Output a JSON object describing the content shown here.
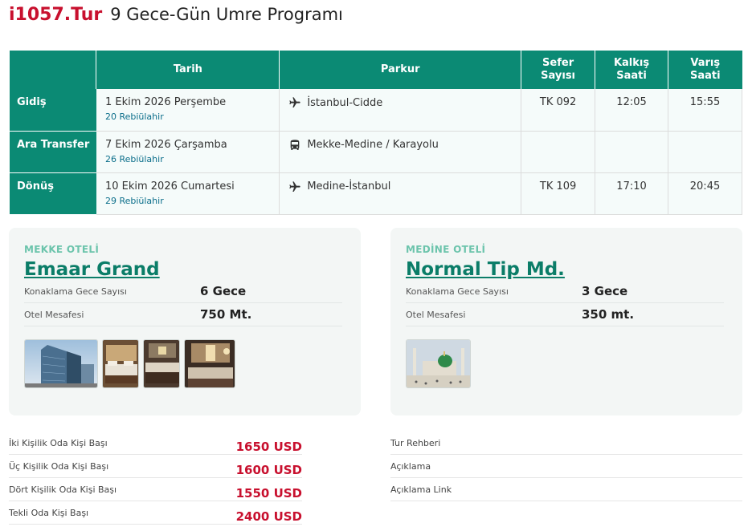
{
  "header": {
    "brand": "i1057.Tur",
    "title": "9 Gece-Gün Umre Programı"
  },
  "schedule": {
    "columns": [
      "Tarih",
      "Parkur",
      "Sefer Sayısı",
      "Kalkış Saati",
      "Varış Saati"
    ],
    "columns_split": [
      [
        "Sefer",
        "Sayısı"
      ],
      [
        "Kalkış",
        "Saati"
      ],
      [
        "Varış",
        "Saati"
      ]
    ],
    "rows": [
      {
        "label": "Gidiş",
        "date": "1 Ekim 2026 Perşembe",
        "hijri": "20 Rebiülahir",
        "icon": "plane-icon",
        "route": "İstanbul-Cidde",
        "flight": "TK 092",
        "dep": "12:05",
        "arr": "15:55"
      },
      {
        "label": "Ara Transfer",
        "date": "7 Ekim 2026 Çarşamba",
        "hijri": "26 Rebiülahir",
        "icon": "bus-icon",
        "route": "Mekke-Medine / Karayolu",
        "flight": "",
        "dep": "",
        "arr": ""
      },
      {
        "label": "Dönüş",
        "date": "10 Ekim 2026 Cumartesi",
        "hijri": "29 Rebiülahir",
        "icon": "plane-icon",
        "route": "Medine-İstanbul",
        "flight": "TK 109",
        "dep": "17:10",
        "arr": "20:45"
      }
    ]
  },
  "hotels": {
    "mekke": {
      "label": "MEKKE OTELİ",
      "name": "Emaar Grand",
      "nights_label": "Konaklama Gece Sayısı",
      "nights": "6 Gece",
      "distance_label": "Otel Mesafesi",
      "distance": "750 Mt."
    },
    "medine": {
      "label": "MEDİNE OTELİ",
      "name": "Normal Tip Md.",
      "nights_label": "Konaklama Gece Sayısı",
      "nights": "3 Gece",
      "distance_label": "Otel Mesafesi",
      "distance": "350 mt."
    }
  },
  "prices": [
    {
      "label": "İki Kişilik Oda Kişi Başı",
      "value": "1650 USD"
    },
    {
      "label": "Üç Kişilik Oda Kişi Başı",
      "value": "1600 USD"
    },
    {
      "label": "Dört Kişilik Oda Kişi Başı",
      "value": "1550 USD"
    },
    {
      "label": "Tekli Oda Kişi Başı",
      "value": "2400 USD"
    }
  ],
  "info": [
    {
      "label": "Tur Rehberi"
    },
    {
      "label": "Açıklama"
    },
    {
      "label": "Açıklama Link"
    }
  ],
  "colors": {
    "accent": "#0b8a74",
    "brand": "#c8102e"
  }
}
